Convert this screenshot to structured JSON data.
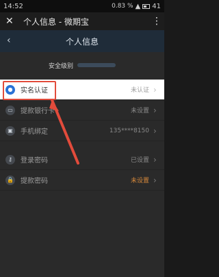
{
  "statusbar": {
    "time": "14:52",
    "battery": "0.83 %",
    "battery_level": "41"
  },
  "appbar": {
    "close_icon": "close-icon",
    "title": "个人信息 - 微期宝",
    "more_icon": "more-vert-icon"
  },
  "navbar": {
    "back_icon": "chevron-left-icon",
    "title": "个人信息"
  },
  "security": {
    "label": "安全级别",
    "level_fraction": 0.22
  },
  "rows": [
    {
      "label": "实名认证",
      "value": "未认证",
      "icon": "user-id-icon"
    },
    {
      "label": "提款银行卡",
      "value": "未设置",
      "icon": "bank-card-icon"
    },
    {
      "label": "手机绑定",
      "value": "135****8150",
      "icon": "phone-icon"
    },
    {
      "label": "登录密码",
      "value": "已设置",
      "icon": "key-icon"
    },
    {
      "label": "提款密码",
      "value": "未设置",
      "icon": "lock-icon"
    }
  ],
  "colors": {
    "highlight": "#ffffff",
    "accent": "#2a72d6",
    "callout": "#e24b3b",
    "warning": "#d6883b"
  }
}
